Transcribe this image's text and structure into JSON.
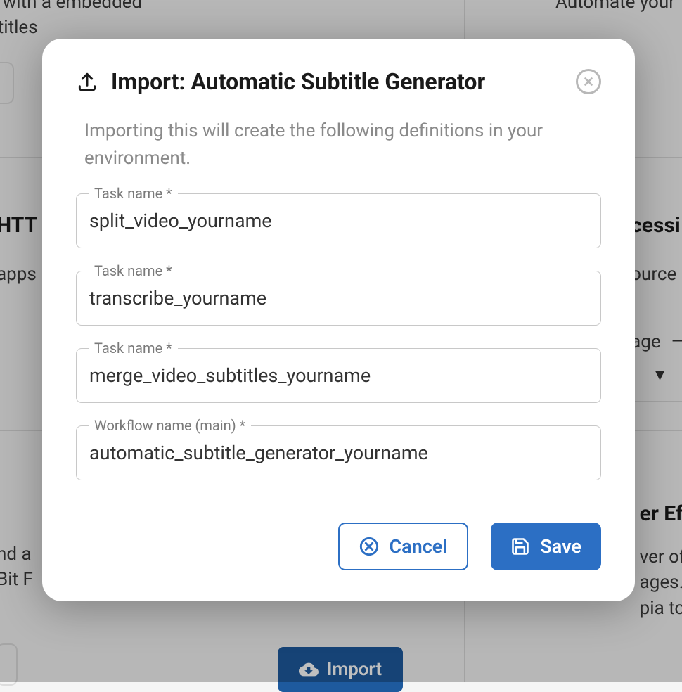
{
  "background": {
    "left_text_1": "utputs a MKV file with a embedded",
    "left_text_2": "ining just the subtitles",
    "heading_left": "HTT",
    "sub_left": "apps",
    "left_text_3": "nd a",
    "left_text_4": "Bit F",
    "import_button": "Import",
    "right_text_1": "Automate your Te",
    "heading_right": "cessi",
    "sub_right": "ource",
    "right_text_2": "age",
    "right_text_3": "er Ef",
    "right_text_4": "ver of",
    "right_text_5": "ages.",
    "right_text_6": "pia to"
  },
  "modal": {
    "title": "Import: Automatic Subtitle Generator",
    "description": "Importing this will create the following definitions in your environment.",
    "fields": [
      {
        "label": "Task name *",
        "value": "split_video_yourname"
      },
      {
        "label": "Task name *",
        "value": "transcribe_yourname"
      },
      {
        "label": "Task name *",
        "value": "merge_video_subtitles_yourname"
      },
      {
        "label": "Workflow name (main) *",
        "value": "automatic_subtitle_generator_yourname"
      }
    ],
    "cancel_label": "Cancel",
    "save_label": "Save"
  }
}
